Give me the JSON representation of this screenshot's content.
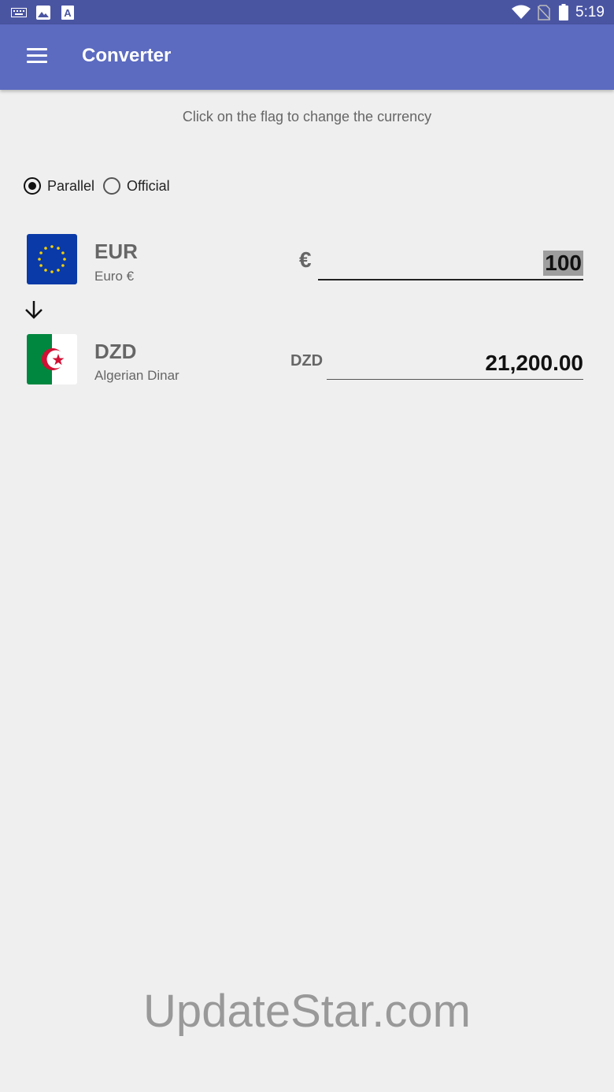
{
  "status_bar": {
    "time": "5:19",
    "icons": [
      "keyboard-icon",
      "image-icon",
      "a-box-icon",
      "wifi-icon",
      "no-sim-icon",
      "battery-icon"
    ]
  },
  "app_bar": {
    "title": "Converter",
    "menu_icon": "hamburger-menu-icon",
    "color": "#5c6bc0"
  },
  "hint": "Click on the flag to change the currency",
  "rate_type": {
    "options": [
      {
        "label": "Parallel",
        "checked": true
      },
      {
        "label": "Official",
        "checked": false
      }
    ]
  },
  "from": {
    "code": "EUR",
    "name": "Euro €",
    "symbol": "€",
    "amount": "100",
    "flag": "eu-flag-icon"
  },
  "to": {
    "code": "DZD",
    "name": "Algerian Dinar",
    "symbol": "DZD",
    "amount": "21,200.00",
    "flag": "algeria-flag-icon"
  },
  "direction_icon": "arrow-down-icon",
  "watermark": "UpdateStar.com"
}
